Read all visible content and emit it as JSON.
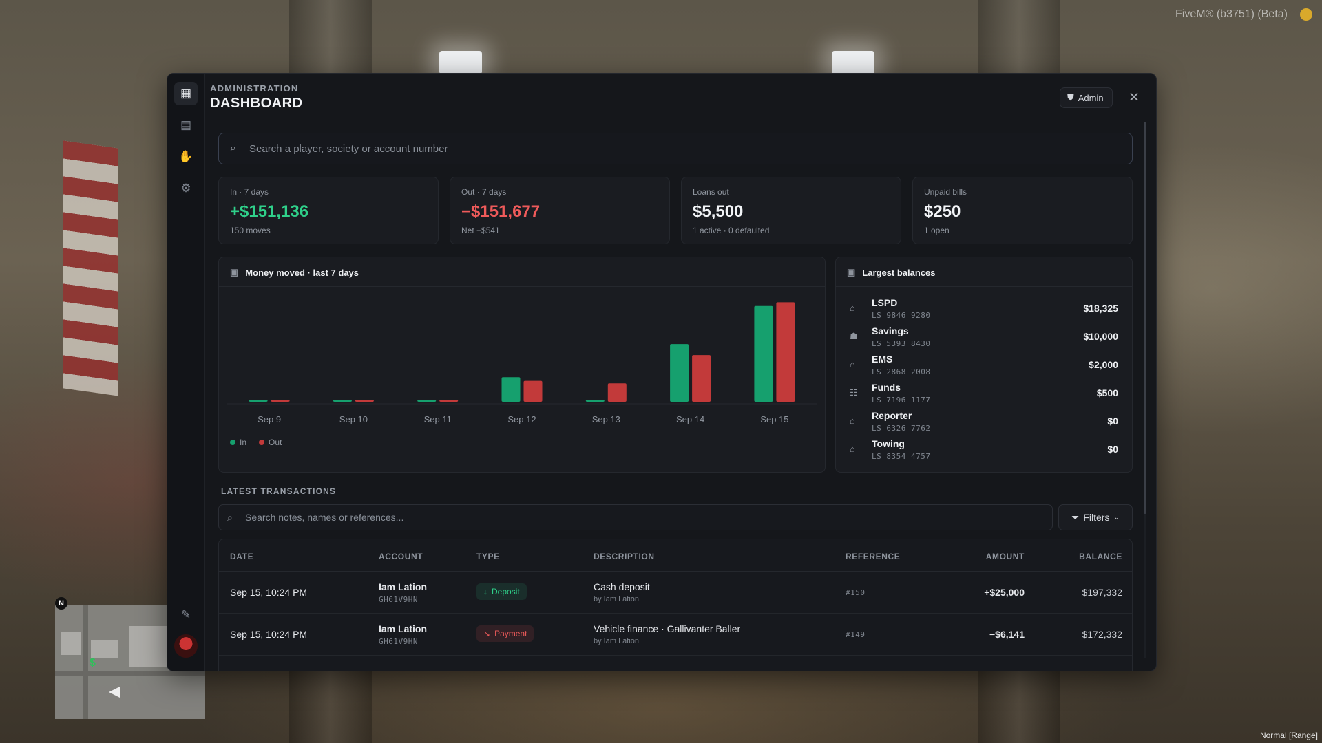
{
  "overlay": {
    "fivem_label": "FiveM® (b3751) (Beta)",
    "range_label": "Normal [Range]",
    "minimap_north": "N",
    "minimap_money": "$"
  },
  "header": {
    "eyebrow": "ADMINISTRATION",
    "title": "DASHBOARD",
    "admin_label": "Admin"
  },
  "search": {
    "placeholder": "Search a player, society or account number"
  },
  "stats": [
    {
      "label": "In · 7 days",
      "value": "+$151,136",
      "sub": "150 moves",
      "tone": "green"
    },
    {
      "label": "Out · 7 days",
      "value": "−$151,677",
      "sub": "Net −$541",
      "tone": "red"
    },
    {
      "label": "Loans out",
      "value": "$5,500",
      "sub": "1 active · 0 defaulted",
      "tone": "white"
    },
    {
      "label": "Unpaid bills",
      "value": "$250",
      "sub": "1 open",
      "tone": "white"
    }
  ],
  "chart_card": {
    "title": "Money moved · last 7 days"
  },
  "chart_data": {
    "type": "bar",
    "title": "Money moved · last 7 days",
    "categories": [
      "Sep 9",
      "Sep 10",
      "Sep 11",
      "Sep 12",
      "Sep 13",
      "Sep 14",
      "Sep 15"
    ],
    "series": [
      {
        "name": "In",
        "color": "#16a06e",
        "values": [
          0,
          0,
          0,
          10000,
          0,
          23500,
          39000
        ]
      },
      {
        "name": "Out",
        "color": "#c23a3a",
        "values": [
          0,
          0,
          0,
          8500,
          7500,
          19000,
          40500
        ]
      }
    ],
    "ylim": [
      0,
      42000
    ],
    "grid": false,
    "legend": "bottom-left"
  },
  "balances": {
    "title": "Largest balances",
    "items": [
      {
        "name": "LSPD",
        "account": "LS 9846 9280",
        "amount": "$18,325",
        "icon": "bank-icon"
      },
      {
        "name": "Savings",
        "account": "LS 5393 8430",
        "amount": "$10,000",
        "icon": "piggy-bank-icon"
      },
      {
        "name": "EMS",
        "account": "LS 2868 2008",
        "amount": "$2,000",
        "icon": "bank-icon"
      },
      {
        "name": "Funds",
        "account": "LS 7196 1177",
        "amount": "$500",
        "icon": "group-icon"
      },
      {
        "name": "Reporter",
        "account": "LS 6326 7762",
        "amount": "$0",
        "icon": "bank-icon"
      },
      {
        "name": "Towing",
        "account": "LS 8354 4757",
        "amount": "$0",
        "icon": "bank-icon"
      }
    ]
  },
  "transactions": {
    "section_label": "LATEST TRANSACTIONS",
    "search_placeholder": "Search notes, names or references...",
    "filters_label": "Filters",
    "columns": {
      "date": "DATE",
      "account": "ACCOUNT",
      "type": "TYPE",
      "description": "DESCRIPTION",
      "reference": "REFERENCE",
      "amount": "AMOUNT",
      "balance": "BALANCE"
    },
    "rows": [
      {
        "date": "Sep 15, 10:24 PM",
        "account_name": "Iam Lation",
        "account_id": "GH61V9HN",
        "type": "Deposit",
        "description": "Cash deposit",
        "by": "by Iam Lation",
        "reference": "#150",
        "amount": "+$25,000",
        "balance": "$197,332"
      },
      {
        "date": "Sep 15, 10:24 PM",
        "account_name": "Iam Lation",
        "account_id": "GH61V9HN",
        "type": "Payment",
        "description": "Vehicle finance · Gallivanter Baller",
        "by": "by Iam Lation",
        "reference": "#149",
        "amount": "−$6,141",
        "balance": "$172,332"
      }
    ]
  }
}
